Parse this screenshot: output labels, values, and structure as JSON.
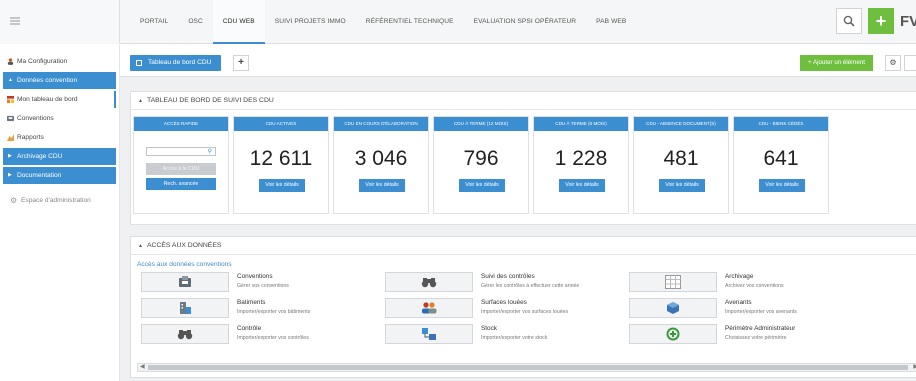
{
  "topbar": {
    "tabs": [
      "PORTAIL",
      "OSC",
      "CDU WEB",
      "SUIVI PROJETS IMMO",
      "RÉFÉRENTIEL TECHNIQUE",
      "EVALUATION SPSI OPÉRATEUR",
      "PAB WEB"
    ],
    "active_tab": "CDU WEB",
    "user_initials": "FV",
    "add_label": "+"
  },
  "sidebar": {
    "items": [
      {
        "label": "Ma Configuration",
        "icon": "user-icon"
      },
      {
        "label": "Données convention",
        "icon": "caret-down-icon"
      },
      {
        "label": "Mon tableau de bord",
        "icon": "dashboard-icon"
      },
      {
        "label": "Conventions",
        "icon": "folder-icon"
      },
      {
        "label": "Rapports",
        "icon": "chart-icon"
      },
      {
        "label": "Archivage CDU",
        "icon": "caret-right-icon"
      },
      {
        "label": "Documentation",
        "icon": "caret-right-icon"
      },
      {
        "label": "Espace d'administration",
        "icon": "gear-icon"
      }
    ]
  },
  "subbar": {
    "dashboard_tab": "Tableau de bord CDU",
    "add_tab": "+",
    "add_element": "+ Ajouter un élément"
  },
  "dashboard": {
    "title": "TABLEAU DE BORD DE SUIVI DES CDU",
    "quick_access": {
      "header": "ACCÈS RAPIDE",
      "button_disabled": "Accès à la CDU",
      "button": "Rech. avancée"
    },
    "kpis": [
      {
        "header": "CDU ACTIVES",
        "value": "12 611",
        "button": "Voir les détails"
      },
      {
        "header": "CDU EN COURS D'ÉLABORATION",
        "value": "3 046",
        "button": "Voir les détails"
      },
      {
        "header": "CDU À TERME (12 MOIS)",
        "value": "796",
        "button": "Voir les détails"
      },
      {
        "header": "CDU À TERME (6 MOIS)",
        "value": "1 228",
        "button": "Voir les détails"
      },
      {
        "header": "CDU - ABSENCE DOCUMENT(S)",
        "value": "481",
        "button": "Voir les détails"
      },
      {
        "header": "CDU - BIENS CÉDÉS",
        "value": "641",
        "button": "Voir les détails"
      }
    ]
  },
  "data_access": {
    "title": "ACCÈS AUX DONNÉES",
    "subtitle": "Accès aux données conventions",
    "items": [
      {
        "title": "Conventions",
        "desc": "Gérer vos conventions",
        "icon": "folder-icon"
      },
      {
        "title": "Suivi des contrôles",
        "desc": "Gérer les contrôles à effectuer cette année",
        "icon": "binoculars-icon"
      },
      {
        "title": "Archivage",
        "desc": "Archivez vos conventions",
        "icon": "archive-grid-icon"
      },
      {
        "title": "Batiments",
        "desc": "Importer/exporter vos bâtiments",
        "icon": "building-icon"
      },
      {
        "title": "Surfaces louées",
        "desc": "Importer/exporter vos surfaces louées",
        "icon": "users-icon"
      },
      {
        "title": "Avenants",
        "desc": "Importer/exporter vos avenants",
        "icon": "cube-icon"
      },
      {
        "title": "Contrôle",
        "desc": "Importer/exporter vos contrôles",
        "icon": "binoculars-icon"
      },
      {
        "title": "Stock",
        "desc": "Importer/exporter votre stock",
        "icon": "stock-icon"
      },
      {
        "title": "Périmètre Administrateur",
        "desc": "Choisissez votre périmètre",
        "icon": "plus-circle-icon"
      }
    ]
  }
}
